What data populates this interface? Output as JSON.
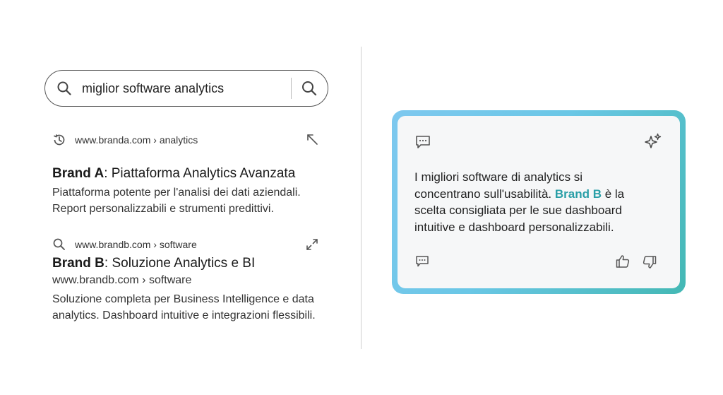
{
  "search": {
    "query": "miglior software analytics",
    "lead_icon": "search-icon",
    "button_icon": "search-icon"
  },
  "results": [
    {
      "row_icon": "history-icon",
      "url": "www.branda.com › analytics",
      "corner_icon": "arrow-up-left-icon",
      "title_brand": "Brand A",
      "title_rest": ": Piattaforma Analytics Avanzata",
      "desc": "Piattaforma potente per l'analisi dei dati aziendali. Report personalizzabili e strumenti predittivi."
    },
    {
      "row_icon": "search-icon",
      "url": "www.brandb.com › software",
      "corner_icon": "expand-icon",
      "title_brand": "Brand B",
      "title_rest": ": Soluzione Analytics e BI",
      "sub_url": "www.brandb.com › software",
      "desc": "Soluzione completa per Business Intelligence e data analytics. Dashboard intuitive e integrazioni flessibili."
    }
  ],
  "ai_answer": {
    "text_before": "I migliori software di analytics si concentrano sull'usabilità. ",
    "brand": "Brand B",
    "text_after": " è la scelta consigliata per le sue dashboard intuitive e dashboard personalizzabili.",
    "icons": [
      "chat-icon",
      "sparkle-icon",
      "comment-icon",
      "thumbs-up-icon",
      "thumbs-down-icon"
    ],
    "accent_color": "#2a9fa7",
    "frame_colors": [
      "#7ec8ef",
      "#43b8b4"
    ]
  }
}
